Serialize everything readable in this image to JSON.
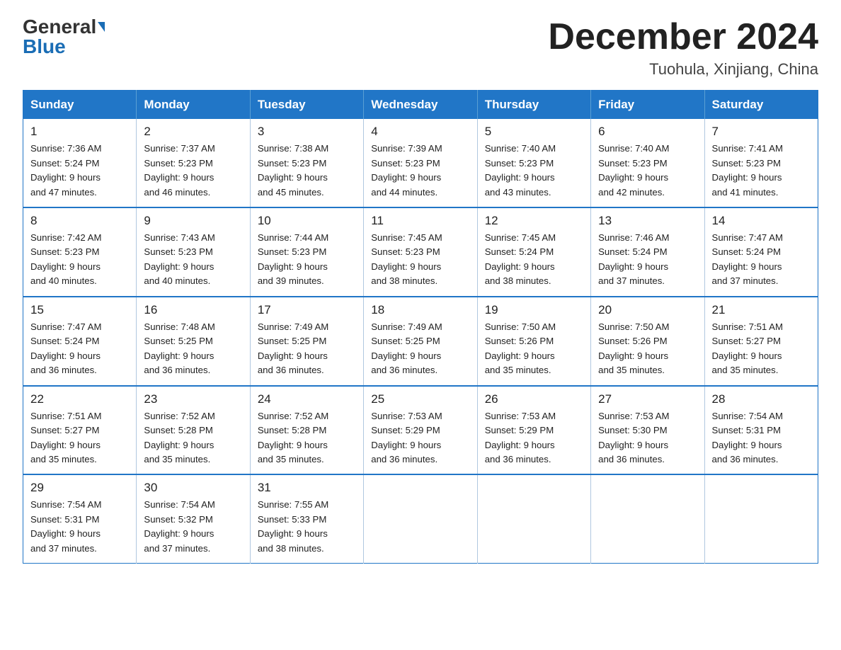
{
  "logo": {
    "general": "General",
    "blue": "Blue"
  },
  "title": "December 2024",
  "location": "Tuohula, Xinjiang, China",
  "days_of_week": [
    "Sunday",
    "Monday",
    "Tuesday",
    "Wednesday",
    "Thursday",
    "Friday",
    "Saturday"
  ],
  "weeks": [
    [
      {
        "day": "1",
        "info": "Sunrise: 7:36 AM\nSunset: 5:24 PM\nDaylight: 9 hours\nand 47 minutes."
      },
      {
        "day": "2",
        "info": "Sunrise: 7:37 AM\nSunset: 5:23 PM\nDaylight: 9 hours\nand 46 minutes."
      },
      {
        "day": "3",
        "info": "Sunrise: 7:38 AM\nSunset: 5:23 PM\nDaylight: 9 hours\nand 45 minutes."
      },
      {
        "day": "4",
        "info": "Sunrise: 7:39 AM\nSunset: 5:23 PM\nDaylight: 9 hours\nand 44 minutes."
      },
      {
        "day": "5",
        "info": "Sunrise: 7:40 AM\nSunset: 5:23 PM\nDaylight: 9 hours\nand 43 minutes."
      },
      {
        "day": "6",
        "info": "Sunrise: 7:40 AM\nSunset: 5:23 PM\nDaylight: 9 hours\nand 42 minutes."
      },
      {
        "day": "7",
        "info": "Sunrise: 7:41 AM\nSunset: 5:23 PM\nDaylight: 9 hours\nand 41 minutes."
      }
    ],
    [
      {
        "day": "8",
        "info": "Sunrise: 7:42 AM\nSunset: 5:23 PM\nDaylight: 9 hours\nand 40 minutes."
      },
      {
        "day": "9",
        "info": "Sunrise: 7:43 AM\nSunset: 5:23 PM\nDaylight: 9 hours\nand 40 minutes."
      },
      {
        "day": "10",
        "info": "Sunrise: 7:44 AM\nSunset: 5:23 PM\nDaylight: 9 hours\nand 39 minutes."
      },
      {
        "day": "11",
        "info": "Sunrise: 7:45 AM\nSunset: 5:23 PM\nDaylight: 9 hours\nand 38 minutes."
      },
      {
        "day": "12",
        "info": "Sunrise: 7:45 AM\nSunset: 5:24 PM\nDaylight: 9 hours\nand 38 minutes."
      },
      {
        "day": "13",
        "info": "Sunrise: 7:46 AM\nSunset: 5:24 PM\nDaylight: 9 hours\nand 37 minutes."
      },
      {
        "day": "14",
        "info": "Sunrise: 7:47 AM\nSunset: 5:24 PM\nDaylight: 9 hours\nand 37 minutes."
      }
    ],
    [
      {
        "day": "15",
        "info": "Sunrise: 7:47 AM\nSunset: 5:24 PM\nDaylight: 9 hours\nand 36 minutes."
      },
      {
        "day": "16",
        "info": "Sunrise: 7:48 AM\nSunset: 5:25 PM\nDaylight: 9 hours\nand 36 minutes."
      },
      {
        "day": "17",
        "info": "Sunrise: 7:49 AM\nSunset: 5:25 PM\nDaylight: 9 hours\nand 36 minutes."
      },
      {
        "day": "18",
        "info": "Sunrise: 7:49 AM\nSunset: 5:25 PM\nDaylight: 9 hours\nand 36 minutes."
      },
      {
        "day": "19",
        "info": "Sunrise: 7:50 AM\nSunset: 5:26 PM\nDaylight: 9 hours\nand 35 minutes."
      },
      {
        "day": "20",
        "info": "Sunrise: 7:50 AM\nSunset: 5:26 PM\nDaylight: 9 hours\nand 35 minutes."
      },
      {
        "day": "21",
        "info": "Sunrise: 7:51 AM\nSunset: 5:27 PM\nDaylight: 9 hours\nand 35 minutes."
      }
    ],
    [
      {
        "day": "22",
        "info": "Sunrise: 7:51 AM\nSunset: 5:27 PM\nDaylight: 9 hours\nand 35 minutes."
      },
      {
        "day": "23",
        "info": "Sunrise: 7:52 AM\nSunset: 5:28 PM\nDaylight: 9 hours\nand 35 minutes."
      },
      {
        "day": "24",
        "info": "Sunrise: 7:52 AM\nSunset: 5:28 PM\nDaylight: 9 hours\nand 35 minutes."
      },
      {
        "day": "25",
        "info": "Sunrise: 7:53 AM\nSunset: 5:29 PM\nDaylight: 9 hours\nand 36 minutes."
      },
      {
        "day": "26",
        "info": "Sunrise: 7:53 AM\nSunset: 5:29 PM\nDaylight: 9 hours\nand 36 minutes."
      },
      {
        "day": "27",
        "info": "Sunrise: 7:53 AM\nSunset: 5:30 PM\nDaylight: 9 hours\nand 36 minutes."
      },
      {
        "day": "28",
        "info": "Sunrise: 7:54 AM\nSunset: 5:31 PM\nDaylight: 9 hours\nand 36 minutes."
      }
    ],
    [
      {
        "day": "29",
        "info": "Sunrise: 7:54 AM\nSunset: 5:31 PM\nDaylight: 9 hours\nand 37 minutes."
      },
      {
        "day": "30",
        "info": "Sunrise: 7:54 AM\nSunset: 5:32 PM\nDaylight: 9 hours\nand 37 minutes."
      },
      {
        "day": "31",
        "info": "Sunrise: 7:55 AM\nSunset: 5:33 PM\nDaylight: 9 hours\nand 38 minutes."
      },
      null,
      null,
      null,
      null
    ]
  ]
}
